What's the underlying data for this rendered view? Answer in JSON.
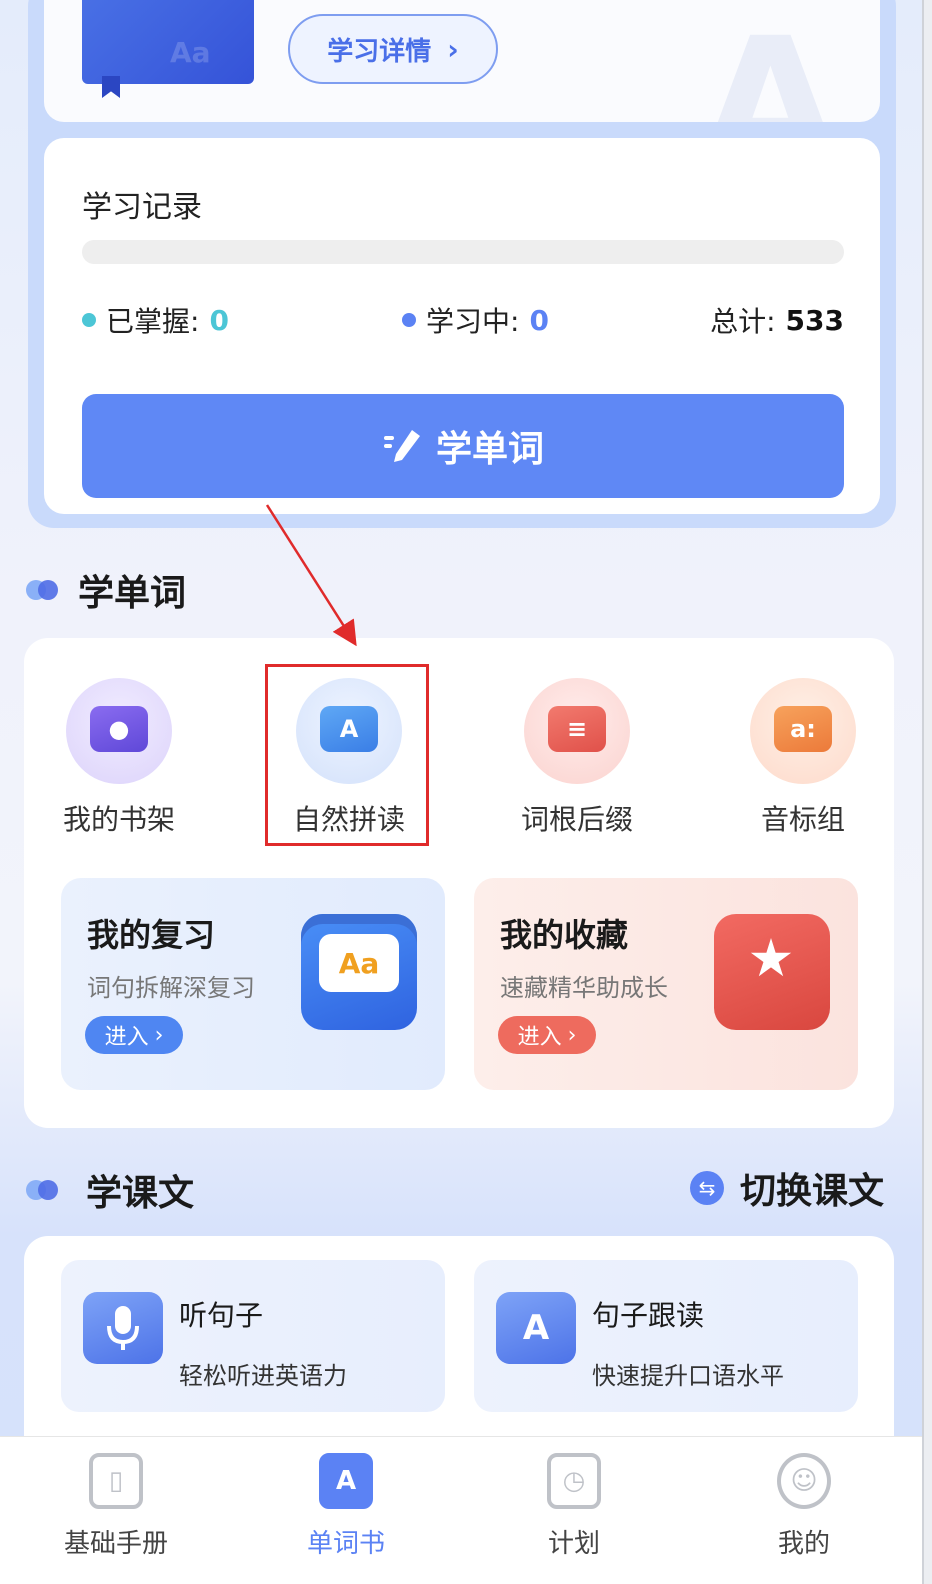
{
  "header": {
    "detail_button": "学习详情",
    "book_cover_text": "Aa"
  },
  "record": {
    "title": "学习记录",
    "progress_fraction": 0,
    "mastered_label": "已掌握:",
    "mastered_value": "0",
    "learning_label": "学习中:",
    "learning_value": "0",
    "total_label": "总计:",
    "total_value": "533",
    "learn_button": "学单词",
    "colors": {
      "mastered_dot": "#4cc6d6",
      "learning_dot": "#5b82f4",
      "button": "#5f88f5"
    }
  },
  "words_section": {
    "title": "学单词",
    "tools": [
      {
        "label": "我的书架",
        "icon": "bookshelf-icon"
      },
      {
        "label": "自然拼读",
        "icon": "phonics-icon"
      },
      {
        "label": "词根后缀",
        "icon": "word-root-icon"
      },
      {
        "label": "音标组",
        "icon": "phonetic-icon"
      }
    ],
    "review": {
      "title": "我的复习",
      "subtitle": "词句拆解深复习",
      "button": "进入",
      "art_text": "Aa"
    },
    "favorites": {
      "title": "我的收藏",
      "subtitle": "速藏精华助成长",
      "button": "进入"
    }
  },
  "text_section": {
    "title": "学课文",
    "switch_label": "切换课文",
    "items": [
      {
        "title": "听句子",
        "subtitle": "轻松听进英语力",
        "icon": "microphone-icon"
      },
      {
        "title": "句子跟读",
        "subtitle": "快速提升口语水平",
        "icon": "folder-a-icon"
      }
    ]
  },
  "bottom_nav": {
    "items": [
      {
        "label": "基础手册",
        "icon": "handbook-icon",
        "active": false
      },
      {
        "label": "单词书",
        "icon": "word-book-icon",
        "active": true
      },
      {
        "label": "计划",
        "icon": "plan-icon",
        "active": false
      },
      {
        "label": "我的",
        "icon": "profile-icon",
        "active": false
      }
    ]
  }
}
